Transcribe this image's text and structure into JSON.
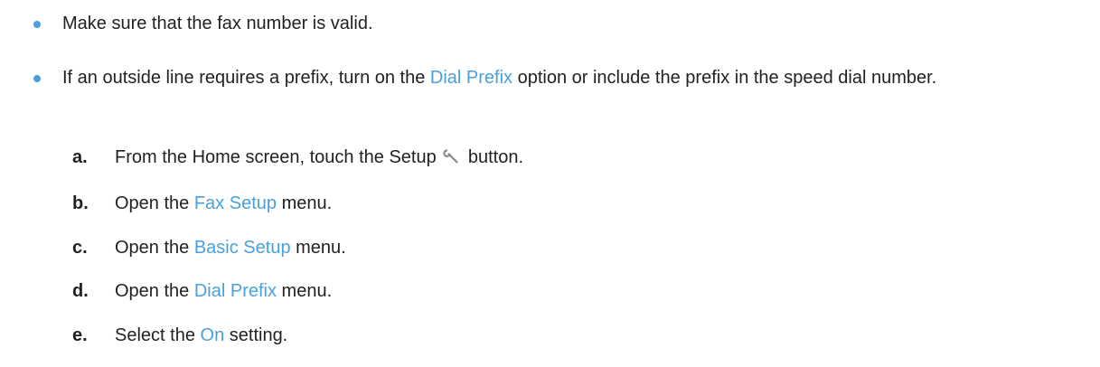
{
  "colors": {
    "accent": "#4aa0dc",
    "text": "#231f20",
    "icon": "#8a8a8a"
  },
  "bullets": [
    {
      "text": "Make sure that the fax number is valid."
    },
    {
      "text_before": "If an outside line requires a prefix, turn on the ",
      "link": "Dial Prefix",
      "text_after": " option or include the prefix in the speed dial number."
    }
  ],
  "steps": [
    {
      "letter": "a.",
      "before": "From the Home screen, touch the Setup ",
      "icon": "wrench-icon",
      "after": " button."
    },
    {
      "letter": "b.",
      "before": "Open the ",
      "link": "Fax Setup",
      "after": " menu."
    },
    {
      "letter": "c.",
      "before": "Open the ",
      "link": "Basic Setup",
      "after": " menu."
    },
    {
      "letter": "d.",
      "before": "Open the ",
      "link": "Dial Prefix",
      "after": " menu."
    },
    {
      "letter": "e.",
      "before": "Select the ",
      "link": "On",
      "after": " setting."
    }
  ]
}
